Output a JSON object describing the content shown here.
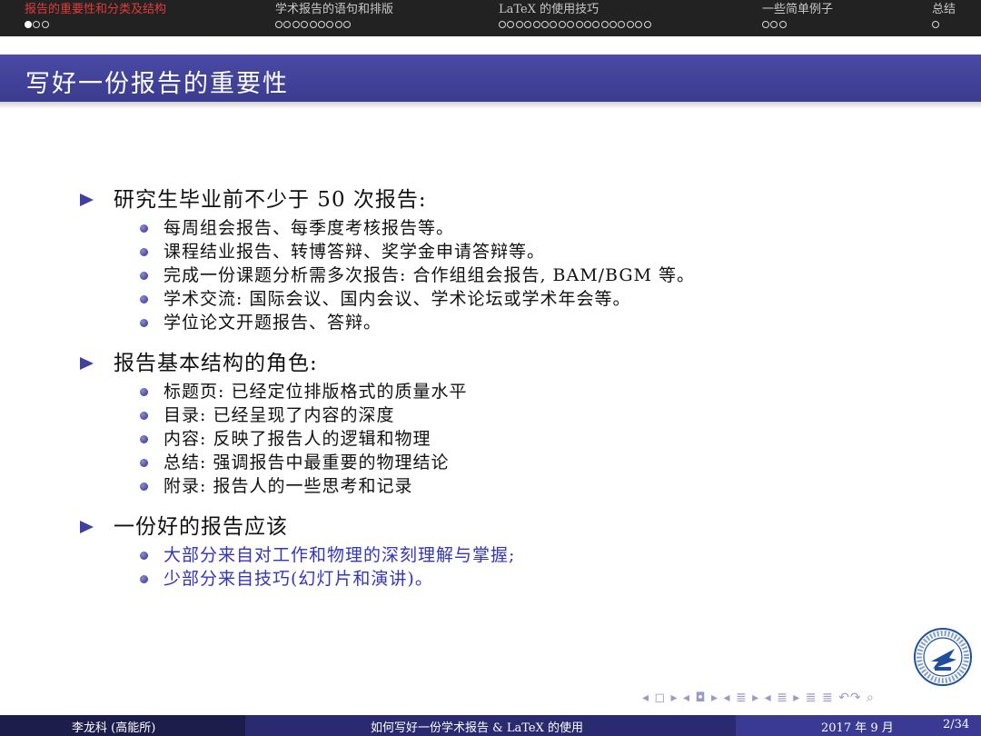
{
  "nav": {
    "sections": [
      {
        "title": "报告的重要性和分类及结构",
        "dots": 3,
        "current": 0
      },
      {
        "title": "学术报告的语句和排版",
        "dots": 9,
        "current": -1
      },
      {
        "title": "LaTeX 的使用技巧",
        "dots": 18,
        "current": -1
      },
      {
        "title": "一些简单例子",
        "dots": 3,
        "current": -1
      },
      {
        "title": "总结",
        "dots": 1,
        "current": -1
      }
    ]
  },
  "frame": {
    "title": "写好一份报告的重要性"
  },
  "content": {
    "sections": [
      {
        "heading": "研究生毕业前不少于 50 次报告:",
        "items": [
          "每周组会报告、每季度考核报告等。",
          "课程结业报告、转博答辩、奖学金申请答辩等。",
          "完成一份课题分析需多次报告: 合作组组会报告, BAM/BGM 等。",
          "学术交流: 国际会议、国内会议、学术论坛或学术年会等。",
          "学位论文开题报告、答辩。"
        ]
      },
      {
        "heading": "报告基本结构的角色:",
        "items": [
          "标题页: 已经定位排版格式的质量水平",
          "目录: 已经呈现了内容的深度",
          "内容: 反映了报告人的逻辑和物理",
          "总结: 强调报告中最重要的物理结论",
          "附录: 报告人的一些思考和记录"
        ]
      },
      {
        "heading": "一份好的报告应该",
        "items": [
          "大部分来自对工作和物理的深刻理解与掌握;",
          "少部分来自技巧(幻灯片和演讲)。"
        ]
      }
    ]
  },
  "nav_symbols": "◂ ◻ ▸ ◂ ◘ ▸ ◂ ≣ ▸ ◂ ≣ ▸ ≣ ≣ ↶↷ ⌕",
  "footer": {
    "author": "李龙科 (高能所)",
    "talk_title": "如何写好一份学术报告 & LaTeX 的使用",
    "date": "2017 年 9 月",
    "page": "2/34"
  },
  "colors": {
    "titlebar": "#3b3b8f",
    "nav_bg": "#222222",
    "nav_active": "#e23a3a",
    "highlight_blue": "#3535b8"
  }
}
